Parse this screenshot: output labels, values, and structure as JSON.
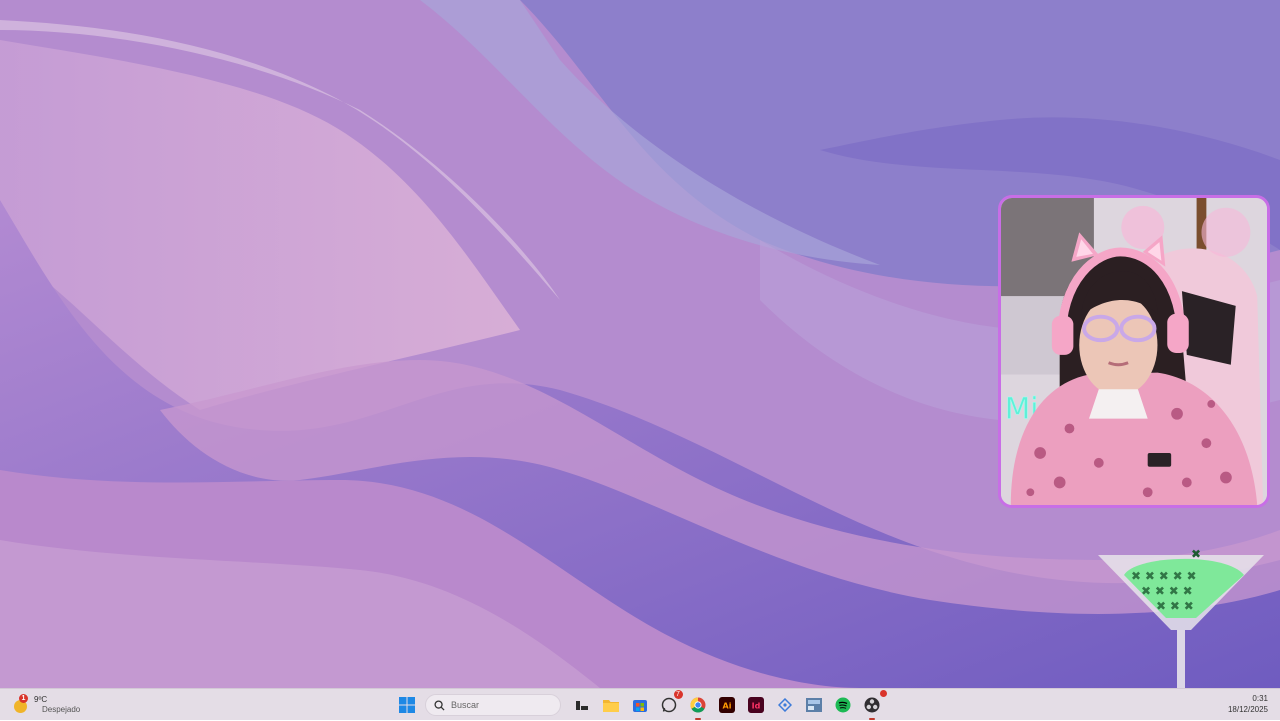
{
  "taskbar": {
    "weather": {
      "badge": "1",
      "temperature": "9ºC",
      "condition": "Despejado",
      "icon": "sun-icon"
    },
    "search": {
      "placeholder": "Buscar"
    },
    "apps": [
      {
        "name": "start",
        "icon": "windows-logo-icon"
      },
      {
        "name": "task-view",
        "icon": "task-view-icon"
      },
      {
        "name": "file-explorer",
        "icon": "folder-icon"
      },
      {
        "name": "microsoft-store",
        "icon": "store-icon"
      },
      {
        "name": "whatsapp",
        "icon": "whatsapp-icon",
        "badge": "7"
      },
      {
        "name": "chrome",
        "icon": "chrome-icon"
      },
      {
        "name": "illustrator",
        "icon": "illustrator-icon",
        "label": "Ai"
      },
      {
        "name": "indesign",
        "icon": "indesign-icon",
        "label": "Id"
      },
      {
        "name": "app-diamond",
        "icon": "diamond-icon"
      },
      {
        "name": "app-thumbnail",
        "icon": "thumbnail-icon"
      },
      {
        "name": "spotify",
        "icon": "spotify-icon"
      },
      {
        "name": "obs",
        "icon": "obs-icon"
      }
    ],
    "clock": {
      "time": "0:31",
      "date": "18/12/2025"
    }
  },
  "overlays": {
    "webcam": {
      "border_color": "#c86ee6",
      "neon_text": "Mi"
    },
    "martini": {
      "liquid_color": "#7fe89a"
    }
  },
  "colors": {
    "taskbar_bg": "#e4dde6",
    "wallpaper_base": "#b98fd0",
    "wallpaper_wave": "#7a62c0"
  }
}
